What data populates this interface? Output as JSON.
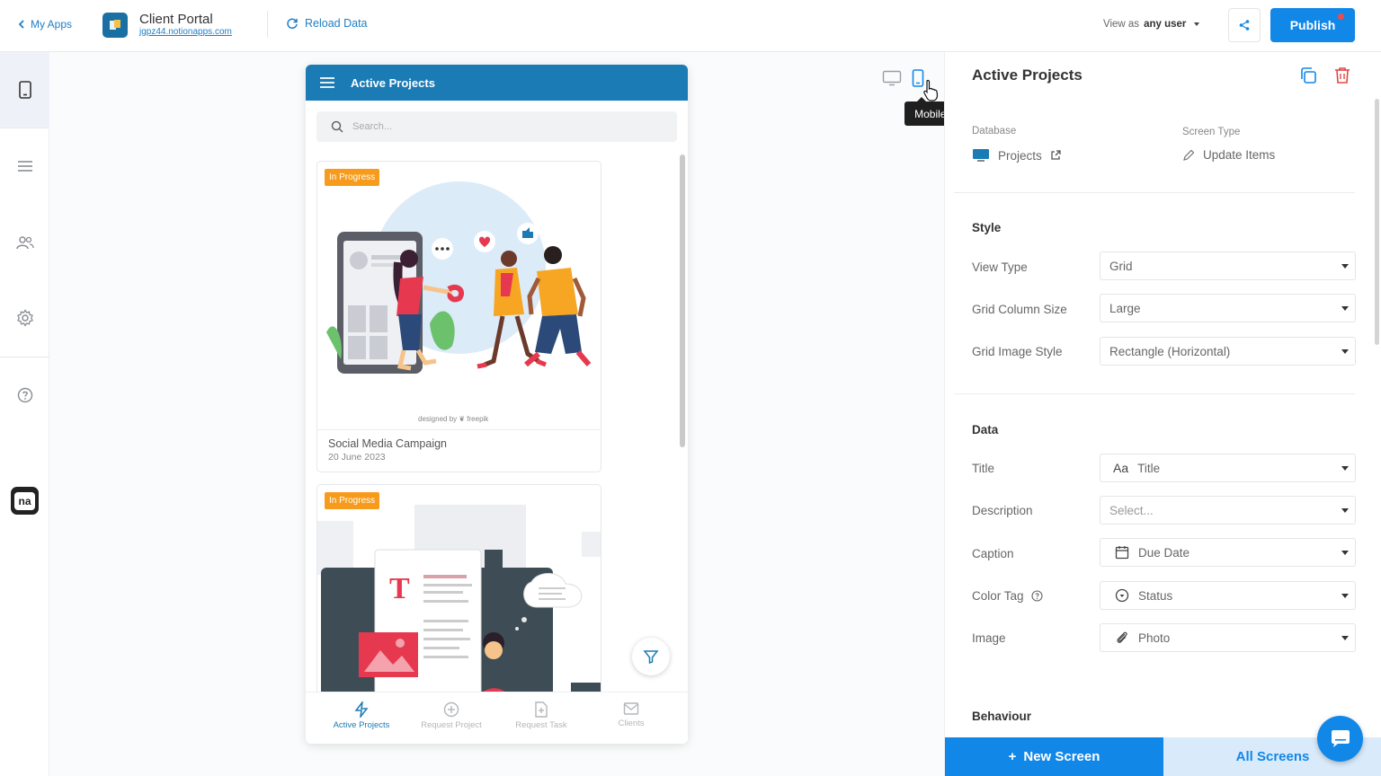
{
  "topbar": {
    "back_label": "My Apps",
    "app_title": "Client Portal",
    "app_url": "jgpz44.notionapps.com",
    "reload_label": "Reload Data",
    "view_as_prefix": "View as",
    "view_as_value": "any user",
    "publish_label": "Publish"
  },
  "device": {
    "tooltip": "Mobile View (m)"
  },
  "phone": {
    "header_title": "Active Projects",
    "search_placeholder": "Search...",
    "cards": [
      {
        "badge": "In Progress",
        "title": "Social Media Campaign",
        "date": "20 June 2023",
        "credit": "designed by ❦ freepik"
      },
      {
        "badge": "In Progress"
      }
    ],
    "nav": [
      {
        "label": "Active Projects",
        "icon": "lightning-icon",
        "active": true
      },
      {
        "label": "Request Project",
        "icon": "plus-circle-icon",
        "active": false
      },
      {
        "label": "Request Task",
        "icon": "file-plus-icon",
        "active": false
      },
      {
        "label": "Clients",
        "icon": "mail-icon",
        "active": false
      }
    ]
  },
  "panel": {
    "title": "Active Projects",
    "database_label": "Database",
    "database_value": "Projects",
    "screen_type_label": "Screen Type",
    "screen_type_value": "Update Items",
    "style_heading": "Style",
    "view_type_label": "View Type",
    "view_type_value": "Grid",
    "grid_column_label": "Grid Column Size",
    "grid_column_value": "Large",
    "grid_image_label": "Grid Image Style",
    "grid_image_value": "Rectangle (Horizontal)",
    "data_heading": "Data",
    "title_label": "Title",
    "title_prefix": "Aa",
    "title_value": "Title",
    "description_label": "Description",
    "description_value": "Select...",
    "caption_label": "Caption",
    "caption_value": "Due Date",
    "color_tag_label": "Color Tag",
    "color_tag_value": "Status",
    "image_label": "Image",
    "image_value": "Photo",
    "behaviour_heading": "Behaviour",
    "new_screen_label": "New Screen",
    "all_screens_label": "All Screens"
  },
  "colors": {
    "accent": "#1187e8",
    "header_blue": "#1a7bb5",
    "badge_orange": "#f79b1c"
  }
}
